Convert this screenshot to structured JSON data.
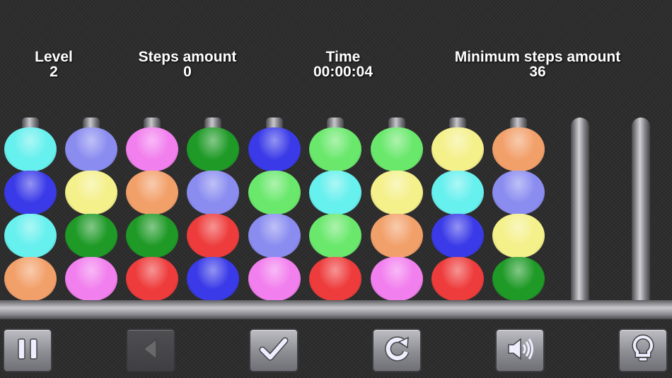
{
  "hud": {
    "level_label": "Level",
    "level_value": "2",
    "steps_label": "Steps amount",
    "steps_value": "0",
    "time_label": "Time",
    "time_value": "00:00:04",
    "min_label": "Minimum steps amount",
    "min_value": "36"
  },
  "colors": {
    "cyan": "#66f0ee",
    "periwinkle": "#8a8cf0",
    "pink": "#f27fee",
    "darkgreen": "#1f9a27",
    "blue": "#3a3ae8",
    "lightgreen": "#6ae86c",
    "yellow": "#f4f08a",
    "orange": "#f2a06a",
    "red": "#ee3c3c"
  },
  "tubes": [
    [
      "cyan",
      "blue",
      "cyan",
      "orange"
    ],
    [
      "periwinkle",
      "yellow",
      "darkgreen",
      "pink"
    ],
    [
      "pink",
      "orange",
      "darkgreen",
      "red"
    ],
    [
      "darkgreen",
      "periwinkle",
      "red",
      "blue"
    ],
    [
      "blue",
      "lightgreen",
      "periwinkle",
      "pink"
    ],
    [
      "lightgreen",
      "cyan",
      "lightgreen",
      "red"
    ],
    [
      "lightgreen",
      "yellow",
      "orange",
      "pink"
    ],
    [
      "yellow",
      "cyan",
      "blue",
      "red"
    ],
    [
      "orange",
      "periwinkle",
      "yellow",
      "darkgreen"
    ],
    [],
    []
  ],
  "buttons": [
    {
      "name": "pause-button",
      "icon": "pause-icon",
      "enabled": true
    },
    {
      "name": "undo-button",
      "icon": "back-arrow-icon",
      "enabled": false
    },
    {
      "name": "check-button",
      "icon": "checkmark-icon",
      "enabled": true
    },
    {
      "name": "restart-button",
      "icon": "refresh-icon",
      "enabled": true
    },
    {
      "name": "sound-button",
      "icon": "speaker-icon",
      "enabled": true
    },
    {
      "name": "hint-button",
      "icon": "lightbulb-icon",
      "enabled": true
    }
  ]
}
